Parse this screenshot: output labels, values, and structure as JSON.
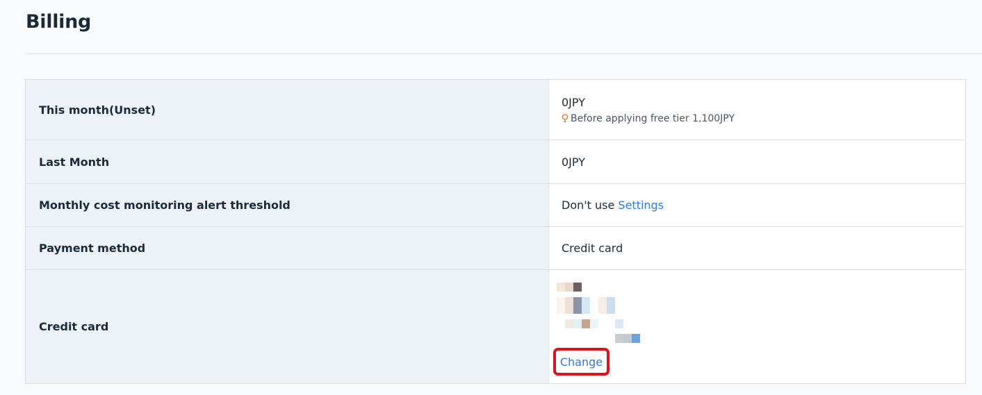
{
  "page": {
    "title": "Billing"
  },
  "billing_rows": {
    "this_month": {
      "label": "This month(Unset)",
      "value": "0JPY",
      "note": "Before applying free tier 1,100JPY",
      "note_icon": "lightbulb-icon"
    },
    "last_month": {
      "label": "Last Month",
      "value": "0JPY"
    },
    "alert_threshold": {
      "label": "Monthly cost monitoring alert threshold",
      "value": "Don't use",
      "settings_link": "Settings"
    },
    "payment_method": {
      "label": "Payment method",
      "value": "Credit card"
    },
    "credit_card": {
      "label": "Credit card",
      "change_link": "Change"
    }
  },
  "colors": {
    "accent_link": "#2f7bd6",
    "label_bg": "#edf2f9",
    "highlight_border": "#d9141c",
    "bulb": "#f07c3a"
  }
}
